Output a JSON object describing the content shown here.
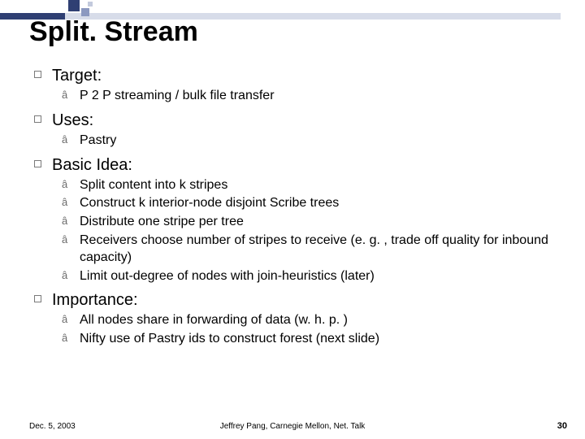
{
  "title": "Split. Stream",
  "sections": [
    {
      "heading": "Target:",
      "items": [
        "P 2 P streaming / bulk file transfer"
      ]
    },
    {
      "heading": "Uses:",
      "items": [
        "Pastry"
      ]
    },
    {
      "heading": "Basic Idea:",
      "items": [
        "Split content into k stripes",
        "Construct k interior-node disjoint Scribe trees",
        "Distribute one stripe per tree",
        "Receivers choose number of stripes to receive (e. g. , trade off quality for inbound capacity)",
        "Limit out-degree of nodes with join-heuristics (later)"
      ]
    },
    {
      "heading": "Importance:",
      "items": [
        "All nodes share in forwarding of data (w. h. p. )",
        "Nifty use of Pastry ids to construct forest (next slide)"
      ]
    }
  ],
  "footer": {
    "date": "Dec. 5, 2003",
    "center": "Jeffrey Pang, Carnegie Mellon, Net. Talk",
    "page": "30"
  }
}
